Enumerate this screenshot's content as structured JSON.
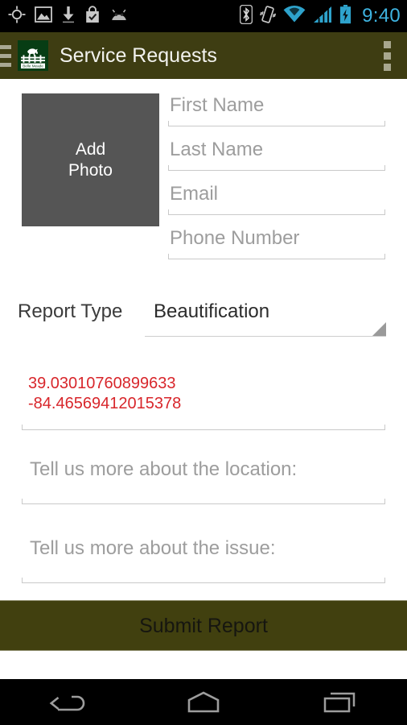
{
  "status_bar": {
    "clock": "9:40",
    "clock_color": "#3eb3e0",
    "left_icons": [
      {
        "name": "gps-location-icon",
        "label": "GPS location"
      },
      {
        "name": "gallery-image-icon",
        "label": "Gallery"
      },
      {
        "name": "download-icon",
        "label": "Download"
      },
      {
        "name": "play-store-bag-icon",
        "label": "Play Store install complete"
      },
      {
        "name": "android-face-icon",
        "label": "Android"
      }
    ],
    "right_icons": [
      {
        "name": "bluetooth-icon",
        "label": "Bluetooth"
      },
      {
        "name": "vibrate-icon",
        "label": "Vibrate mode"
      },
      {
        "name": "wifi-icon",
        "label": "Wi-Fi"
      },
      {
        "name": "cellular-signal-icon",
        "label": "Cellular signal"
      },
      {
        "name": "battery-charging-icon",
        "label": "Battery charging"
      }
    ]
  },
  "app_bar": {
    "title": "Service Requests",
    "background": "#3e3d12",
    "logo": {
      "name": "belle-meade-logo",
      "caption": "Belle Meade",
      "background": "#073d14"
    },
    "drawer_icon": "hamburger-menu-icon",
    "overflow_icon": "overflow-menu-icon"
  },
  "form": {
    "photo": {
      "line1": "Add",
      "line2": "Photo",
      "background": "#555555"
    },
    "fields": [
      {
        "name": "first-name",
        "placeholder": "First Name",
        "value": ""
      },
      {
        "name": "last-name",
        "placeholder": "Last Name",
        "value": ""
      },
      {
        "name": "email",
        "placeholder": "Email",
        "value": ""
      },
      {
        "name": "phone-number",
        "placeholder": "Phone Number",
        "value": ""
      }
    ],
    "report_type": {
      "label": "Report Type",
      "selected": "Beautification"
    },
    "coordinates": {
      "latitude": "39.03010760899633",
      "longitude": "-84.46569412015378",
      "color": "#d8262b"
    },
    "location_notes": {
      "placeholder": "Tell us more about the location:",
      "value": ""
    },
    "issue_notes": {
      "placeholder": "Tell us more about the issue:",
      "value": ""
    },
    "submit": {
      "label": "Submit Report",
      "background": "#41400f"
    }
  },
  "nav_bar": {
    "back": "back-button",
    "home": "home-button",
    "recents": "recent-apps-button"
  }
}
